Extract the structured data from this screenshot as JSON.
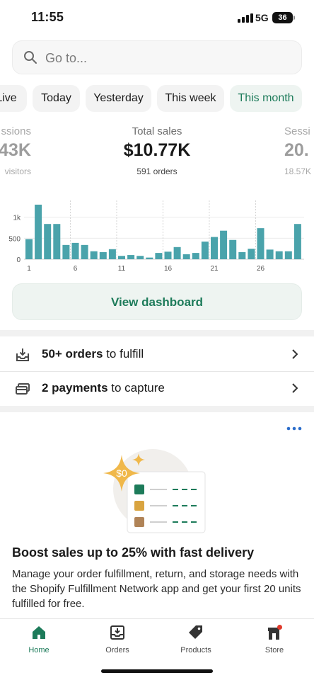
{
  "status_bar": {
    "time": "11:55",
    "network": "5G",
    "battery": "36"
  },
  "search": {
    "placeholder": "Go to..."
  },
  "date_filters": [
    {
      "label": "Live",
      "active": false
    },
    {
      "label": "Today",
      "active": false
    },
    {
      "label": "Yesterday",
      "active": false
    },
    {
      "label": "This week",
      "active": false
    },
    {
      "label": "This month",
      "active": true
    }
  ],
  "metrics": {
    "left": {
      "label": "ssions",
      "value": "43K",
      "sub": "visitors"
    },
    "center": {
      "label": "Total sales",
      "value": "$10.77K",
      "sub": "591 orders"
    },
    "right": {
      "label": "Sessi",
      "value": "20.",
      "sub": "18.57K"
    }
  },
  "chart_data": {
    "type": "bar",
    "categories": [
      "1",
      "2",
      "3",
      "4",
      "5",
      "6",
      "7",
      "8",
      "9",
      "10",
      "11",
      "12",
      "13",
      "14",
      "15",
      "16",
      "17",
      "18",
      "19",
      "20",
      "21",
      "22",
      "23",
      "24",
      "25",
      "26",
      "27",
      "28",
      "29",
      "30"
    ],
    "values": [
      480,
      1300,
      840,
      840,
      340,
      390,
      340,
      190,
      170,
      240,
      80,
      100,
      80,
      40,
      150,
      180,
      290,
      120,
      150,
      420,
      530,
      680,
      460,
      170,
      250,
      740,
      230,
      190,
      190,
      840
    ],
    "y_ticks": [
      "0",
      "500",
      "1k"
    ],
    "y_tick_values": [
      0,
      500,
      1000
    ],
    "x_tick_labels": [
      "1",
      "6",
      "11",
      "16",
      "21",
      "26"
    ],
    "ylim": [
      0,
      1400
    ],
    "color": "#4aa3ab",
    "title": "",
    "xlabel": "",
    "ylabel": ""
  },
  "dashboard_button": {
    "label": "View dashboard"
  },
  "tasks": [
    {
      "bold": "50+ orders",
      "rest": " to fulfill",
      "icon": "inbox-download-icon"
    },
    {
      "bold": "2 payments",
      "rest": " to capture",
      "icon": "credit-card-icon"
    }
  ],
  "promo": {
    "badge": "$0",
    "title": "Boost sales up to 25% with fast delivery",
    "body": "Manage your order fulfillment, return, and storage needs with the Shopify Fulfillment Network app and get your first 20 units fulfilled for free."
  },
  "bottom_nav": [
    {
      "label": "Home",
      "icon": "home-icon",
      "active": true
    },
    {
      "label": "Orders",
      "icon": "orders-icon",
      "active": false
    },
    {
      "label": "Products",
      "icon": "tag-icon",
      "active": false
    },
    {
      "label": "Store",
      "icon": "store-icon",
      "active": false
    }
  ],
  "colors": {
    "accent": "#1d7b5a",
    "bar": "#4aa3ab",
    "link": "#2c6ecb",
    "notification": "#e0392b"
  }
}
